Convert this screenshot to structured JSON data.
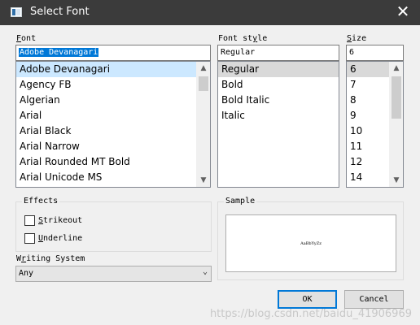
{
  "window": {
    "title": "Select Font"
  },
  "font": {
    "label_first": "F",
    "label_rest": "ont",
    "value": "Adobe Devanagari",
    "items": [
      "Adobe Devanagari",
      "Agency FB",
      "Algerian",
      "Arial",
      "Arial Black",
      "Arial Narrow",
      "Arial Rounded MT Bold",
      "Arial Unicode MS"
    ]
  },
  "style": {
    "label_pre": "Font st",
    "label_u": "y",
    "label_post": "le",
    "value": "Regular",
    "items": [
      "Regular",
      "Bold",
      "Bold Italic",
      "Italic"
    ]
  },
  "size": {
    "label_first": "S",
    "label_rest": "ize",
    "value": "6",
    "items": [
      "6",
      "7",
      "8",
      "9",
      "10",
      "11",
      "12",
      "14"
    ]
  },
  "effects": {
    "label": "Effects",
    "strikeout_first": "S",
    "strikeout_rest": "trikeout",
    "underline_first": "U",
    "underline_rest": "nderline"
  },
  "writing_system": {
    "label_first": "W",
    "label_u": "r",
    "label_rest": "iting System",
    "value": "Any"
  },
  "sample": {
    "label": "Sample",
    "text": "AaBbYyZz"
  },
  "buttons": {
    "ok": "OK",
    "cancel": "Cancel"
  },
  "watermark": "https://blog.csdn.net/baidu_41906969"
}
